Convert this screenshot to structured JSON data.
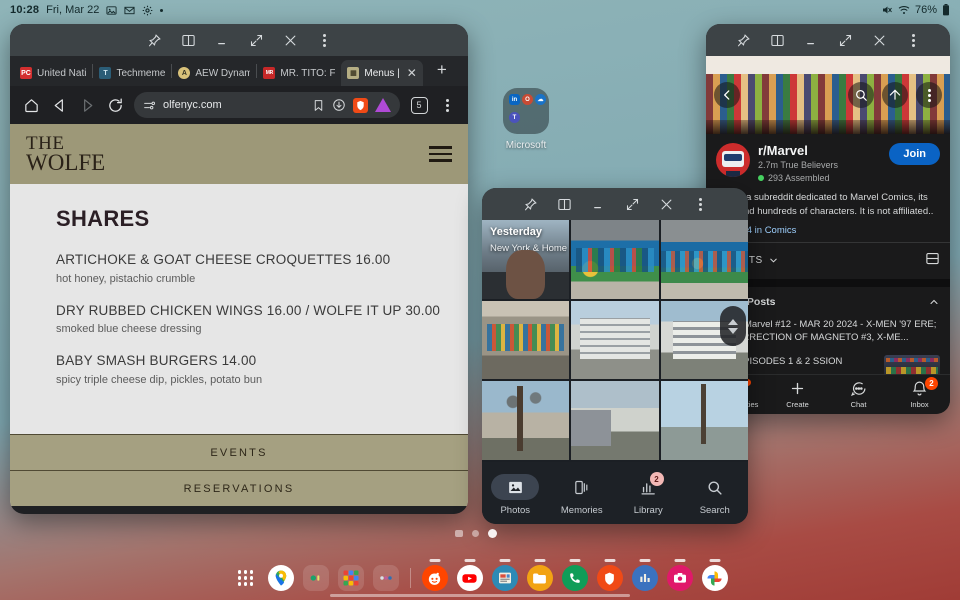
{
  "statusbar": {
    "time": "10:28",
    "date": "Fri, Mar 22",
    "icons": [
      "image-icon",
      "gmail-icon",
      "gear-icon",
      "dot-icon"
    ],
    "battery": "76%",
    "right_icons": [
      "mute-icon",
      "wifi-icon",
      "battery-icon"
    ]
  },
  "browser_window": {
    "controls": [
      "pin-icon",
      "split-screen-icon",
      "minimize-icon",
      "maximize-icon",
      "close-icon",
      "more-icon"
    ],
    "tabs": [
      {
        "label": "United Nati",
        "favicon": "pc-icon"
      },
      {
        "label": "Techmeme",
        "favicon": "techmeme-icon"
      },
      {
        "label": "AEW Dynam",
        "favicon": "aew-icon"
      },
      {
        "label": "MR. TITO: F",
        "favicon": "tito-icon"
      },
      {
        "label": "Menus |",
        "favicon": "menus-icon",
        "active": true
      }
    ],
    "new_tab_label": "+",
    "toolbar": {
      "home_icon": "home-icon",
      "back_icon": "back-icon",
      "forward_icon": "forward-icon",
      "reload_icon": "reload-icon",
      "site_settings_icon": "tune-icon",
      "url": "olfenyc.com",
      "bookmark_icon": "bookmark-icon",
      "download_icon": "download-icon",
      "brave_icon": "brave-shield-icon",
      "vpn_icon": "leo-icon",
      "tab_count": "5",
      "menu_icon": "kebab-menu-icon"
    },
    "page": {
      "logo_line1": "THE",
      "logo_line2": "WOLFE",
      "menu_icon": "hamburger-icon",
      "section_title": "SHARES",
      "items": [
        {
          "name": "ARTICHOKE & GOAT CHEESE CROQUETTES 16.00",
          "desc": "hot honey, pistachio crumble"
        },
        {
          "name": "DRY RUBBED CHICKEN WINGS 16.00 / WOLFE IT UP 30.00",
          "desc": "smoked blue cheese dressing"
        },
        {
          "name": "BABY SMASH BURGERS 14.00",
          "desc": "spicy triple cheese dip, pickles, potato bun"
        }
      ],
      "buttons": [
        "EVENTS",
        "RESERVATIONS"
      ]
    }
  },
  "reddit_window": {
    "controls": [
      "pin-icon",
      "split-screen-icon",
      "minimize-icon",
      "maximize-icon",
      "close-icon",
      "more-icon"
    ],
    "banner_actions": [
      "back-icon",
      "search-icon",
      "share-icon",
      "more-icon"
    ],
    "subreddit": "r/Marvel",
    "members": "2.7m True Believers",
    "online": "293 Assembled",
    "join_label": "Join",
    "description": "This is a subreddit dedicated to Marvel Comics, its  tions and hundreds of characters. It is not affiliated..",
    "more_link": "re",
    "rank": "#4 in Comics",
    "sort_label": "T POSTS",
    "layout_icon": "card-layout-icon",
    "pinned_header": "inned Posts",
    "pinned_collapse_icon": "chevron-up-icon",
    "posts": [
      {
        "title": "eek in Marvel #12 - MAR 20 2024 - X-MEN '97 ERE; RESURRECTION OF MAGNETO #3, X-ME...",
        "thumb": false
      },
      {
        "title": "'97 - EPISODES 1 & 2 SSION",
        "thumb": true
      }
    ],
    "bottom_nav": [
      {
        "label": "Communities",
        "icon": "communities-icon",
        "dot": true
      },
      {
        "label": "Create",
        "icon": "plus-icon"
      },
      {
        "label": "Chat",
        "icon": "chat-icon"
      },
      {
        "label": "Inbox",
        "icon": "bell-icon",
        "badge": "2"
      }
    ]
  },
  "photos_window": {
    "controls": [
      "pin-icon",
      "split-screen-icon",
      "minimize-icon",
      "maximize-icon",
      "close-icon",
      "more-icon"
    ],
    "group_label": "Yesterday",
    "group_sub": "New York & Home",
    "scrollbar_icon": "scroll-thumb-icon",
    "bottom_nav": [
      {
        "label": "Photos",
        "icon": "photos-icon",
        "active": true
      },
      {
        "label": "Memories",
        "icon": "memories-icon"
      },
      {
        "label": "Library",
        "icon": "library-icon",
        "badge": "2"
      },
      {
        "label": "Search",
        "icon": "search-icon"
      }
    ]
  },
  "desktop": {
    "folder_label": "Microsoft",
    "folder_apps": [
      "in",
      "O",
      "O",
      "T"
    ],
    "page_dots": 3
  },
  "taskbar": {
    "apps_icon": "app-drawer-icon",
    "items": [
      {
        "name": "maps",
        "glyph": ""
      },
      {
        "name": "recent-app-1",
        "glyph": ""
      },
      {
        "name": "app-grid",
        "glyph": ""
      },
      {
        "name": "recent-app-2",
        "glyph": ""
      },
      {
        "name": "reddit",
        "glyph": ""
      },
      {
        "name": "youtube",
        "glyph": ""
      },
      {
        "name": "news",
        "glyph": ""
      },
      {
        "name": "files",
        "glyph": ""
      },
      {
        "name": "phone",
        "glyph": ""
      },
      {
        "name": "brave",
        "glyph": ""
      },
      {
        "name": "analytics",
        "glyph": ""
      },
      {
        "name": "camera",
        "glyph": ""
      },
      {
        "name": "google-photos",
        "glyph": ""
      }
    ]
  },
  "colors": {
    "accent_blue": "#0a63c4",
    "reddit_orange": "#ff4500",
    "wolfe_olive": "#9d9878",
    "desktop_teal": "#8fb4b8",
    "desktop_red": "#a03c36"
  }
}
